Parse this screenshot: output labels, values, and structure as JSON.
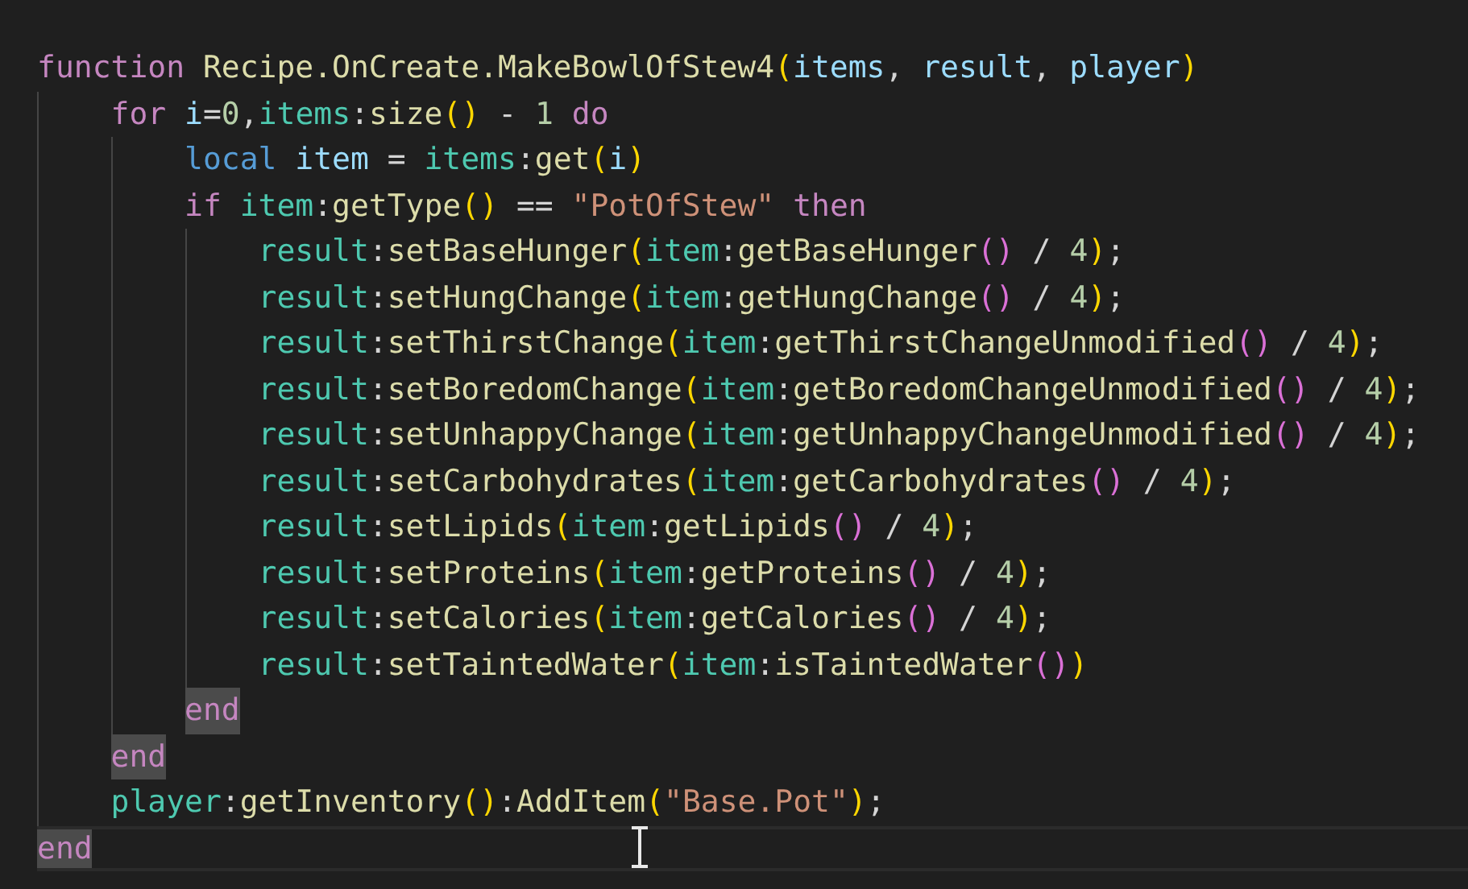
{
  "editor": {
    "lines": [
      {
        "current": false,
        "tokens": [
          {
            "kind": "keyword",
            "text": "function",
            "highlighted": false,
            "space_after": true
          },
          {
            "kind": "function",
            "text": "Recipe.OnCreate.MakeBowlOfStew4"
          },
          {
            "kind": "bracket",
            "text": "(",
            "color": "#ffd700"
          },
          {
            "kind": "parameter",
            "text": "items"
          },
          {
            "kind": "operator",
            "text": ",",
            "space_after": true
          },
          {
            "kind": "parameter",
            "text": "result"
          },
          {
            "kind": "operator",
            "text": ",",
            "space_after": true
          },
          {
            "kind": "parameter",
            "text": "player"
          },
          {
            "kind": "bracket",
            "text": ")",
            "color": "#ffd700"
          }
        ],
        "children": [
          {
            "current": false,
            "tokens": [
              {
                "kind": "keyword",
                "text": "for",
                "highlighted": false,
                "space_after": true
              },
              {
                "kind": "parameter",
                "text": "i"
              },
              {
                "kind": "operator",
                "text": "="
              },
              {
                "kind": "number",
                "text": "0"
              },
              {
                "kind": "operator",
                "text": ","
              },
              {
                "kind": "object",
                "text": "items"
              },
              {
                "kind": "operator",
                "text": ":"
              },
              {
                "kind": "function",
                "text": "size"
              },
              {
                "kind": "bracket",
                "text": "(",
                "color": "#ffd700"
              },
              {
                "kind": "bracket",
                "text": ")",
                "color": "#ffd700",
                "space_after": true
              },
              {
                "kind": "operator",
                "text": "-",
                "space_after": true
              },
              {
                "kind": "number",
                "text": "1",
                "space_after": true
              },
              {
                "kind": "keyword",
                "text": "do",
                "highlighted": false
              }
            ],
            "children": [
              {
                "current": false,
                "tokens": [
                  {
                    "kind": "storage",
                    "text": "local",
                    "space_after": true
                  },
                  {
                    "kind": "parameter",
                    "text": "item",
                    "space_after": true
                  },
                  {
                    "kind": "operator",
                    "text": "=",
                    "space_after": true
                  },
                  {
                    "kind": "object",
                    "text": "items"
                  },
                  {
                    "kind": "operator",
                    "text": ":"
                  },
                  {
                    "kind": "function",
                    "text": "get"
                  },
                  {
                    "kind": "bracket",
                    "text": "(",
                    "color": "#ffd700"
                  },
                  {
                    "kind": "parameter",
                    "text": "i"
                  },
                  {
                    "kind": "bracket",
                    "text": ")",
                    "color": "#ffd700"
                  }
                ]
              },
              {
                "current": false,
                "tokens": [
                  {
                    "kind": "keyword",
                    "text": "if",
                    "highlighted": false,
                    "space_after": true
                  },
                  {
                    "kind": "object",
                    "text": "item"
                  },
                  {
                    "kind": "operator",
                    "text": ":"
                  },
                  {
                    "kind": "function",
                    "text": "getType"
                  },
                  {
                    "kind": "bracket",
                    "text": "(",
                    "color": "#ffd700"
                  },
                  {
                    "kind": "bracket",
                    "text": ")",
                    "color": "#ffd700",
                    "space_after": true
                  },
                  {
                    "kind": "operator",
                    "text": "==",
                    "space_after": true
                  },
                  {
                    "kind": "string",
                    "text": "\"PotOfStew\"",
                    "space_after": true
                  },
                  {
                    "kind": "keyword",
                    "text": "then",
                    "highlighted": false
                  }
                ],
                "children": [
                  {
                    "current": false,
                    "tokens": [
                      {
                        "kind": "object",
                        "text": "result"
                      },
                      {
                        "kind": "operator",
                        "text": ":"
                      },
                      {
                        "kind": "function",
                        "text": "setBaseHunger"
                      },
                      {
                        "kind": "bracket",
                        "text": "(",
                        "color": "#ffd700"
                      },
                      {
                        "kind": "object",
                        "text": "item"
                      },
                      {
                        "kind": "operator",
                        "text": ":"
                      },
                      {
                        "kind": "function",
                        "text": "getBaseHunger"
                      },
                      {
                        "kind": "bracket",
                        "text": "(",
                        "color": "#da70d6"
                      },
                      {
                        "kind": "bracket",
                        "text": ")",
                        "color": "#da70d6",
                        "space_after": true
                      },
                      {
                        "kind": "operator",
                        "text": "/",
                        "space_after": true
                      },
                      {
                        "kind": "number",
                        "text": "4"
                      },
                      {
                        "kind": "bracket",
                        "text": ")",
                        "color": "#ffd700"
                      },
                      {
                        "kind": "operator",
                        "text": ";"
                      }
                    ]
                  },
                  {
                    "current": false,
                    "tokens": [
                      {
                        "kind": "object",
                        "text": "result"
                      },
                      {
                        "kind": "operator",
                        "text": ":"
                      },
                      {
                        "kind": "function",
                        "text": "setHungChange"
                      },
                      {
                        "kind": "bracket",
                        "text": "(",
                        "color": "#ffd700"
                      },
                      {
                        "kind": "object",
                        "text": "item"
                      },
                      {
                        "kind": "operator",
                        "text": ":"
                      },
                      {
                        "kind": "function",
                        "text": "getHungChange"
                      },
                      {
                        "kind": "bracket",
                        "text": "(",
                        "color": "#da70d6"
                      },
                      {
                        "kind": "bracket",
                        "text": ")",
                        "color": "#da70d6",
                        "space_after": true
                      },
                      {
                        "kind": "operator",
                        "text": "/",
                        "space_after": true
                      },
                      {
                        "kind": "number",
                        "text": "4"
                      },
                      {
                        "kind": "bracket",
                        "text": ")",
                        "color": "#ffd700"
                      },
                      {
                        "kind": "operator",
                        "text": ";"
                      }
                    ]
                  },
                  {
                    "current": false,
                    "tokens": [
                      {
                        "kind": "object",
                        "text": "result"
                      },
                      {
                        "kind": "operator",
                        "text": ":"
                      },
                      {
                        "kind": "function",
                        "text": "setThirstChange"
                      },
                      {
                        "kind": "bracket",
                        "text": "(",
                        "color": "#ffd700"
                      },
                      {
                        "kind": "object",
                        "text": "item"
                      },
                      {
                        "kind": "operator",
                        "text": ":"
                      },
                      {
                        "kind": "function",
                        "text": "getThirstChangeUnmodified"
                      },
                      {
                        "kind": "bracket",
                        "text": "(",
                        "color": "#da70d6"
                      },
                      {
                        "kind": "bracket",
                        "text": ")",
                        "color": "#da70d6",
                        "space_after": true
                      },
                      {
                        "kind": "operator",
                        "text": "/",
                        "space_after": true
                      },
                      {
                        "kind": "number",
                        "text": "4"
                      },
                      {
                        "kind": "bracket",
                        "text": ")",
                        "color": "#ffd700"
                      },
                      {
                        "kind": "operator",
                        "text": ";"
                      }
                    ]
                  },
                  {
                    "current": false,
                    "tokens": [
                      {
                        "kind": "object",
                        "text": "result"
                      },
                      {
                        "kind": "operator",
                        "text": ":"
                      },
                      {
                        "kind": "function",
                        "text": "setBoredomChange"
                      },
                      {
                        "kind": "bracket",
                        "text": "(",
                        "color": "#ffd700"
                      },
                      {
                        "kind": "object",
                        "text": "item"
                      },
                      {
                        "kind": "operator",
                        "text": ":"
                      },
                      {
                        "kind": "function",
                        "text": "getBoredomChangeUnmodified"
                      },
                      {
                        "kind": "bracket",
                        "text": "(",
                        "color": "#da70d6"
                      },
                      {
                        "kind": "bracket",
                        "text": ")",
                        "color": "#da70d6",
                        "space_after": true
                      },
                      {
                        "kind": "operator",
                        "text": "/",
                        "space_after": true
                      },
                      {
                        "kind": "number",
                        "text": "4"
                      },
                      {
                        "kind": "bracket",
                        "text": ")",
                        "color": "#ffd700"
                      },
                      {
                        "kind": "operator",
                        "text": ";"
                      }
                    ]
                  },
                  {
                    "current": false,
                    "tokens": [
                      {
                        "kind": "object",
                        "text": "result"
                      },
                      {
                        "kind": "operator",
                        "text": ":"
                      },
                      {
                        "kind": "function",
                        "text": "setUnhappyChange"
                      },
                      {
                        "kind": "bracket",
                        "text": "(",
                        "color": "#ffd700"
                      },
                      {
                        "kind": "object",
                        "text": "item"
                      },
                      {
                        "kind": "operator",
                        "text": ":"
                      },
                      {
                        "kind": "function",
                        "text": "getUnhappyChangeUnmodified"
                      },
                      {
                        "kind": "bracket",
                        "text": "(",
                        "color": "#da70d6"
                      },
                      {
                        "kind": "bracket",
                        "text": ")",
                        "color": "#da70d6",
                        "space_after": true
                      },
                      {
                        "kind": "operator",
                        "text": "/",
                        "space_after": true
                      },
                      {
                        "kind": "number",
                        "text": "4"
                      },
                      {
                        "kind": "bracket",
                        "text": ")",
                        "color": "#ffd700"
                      },
                      {
                        "kind": "operator",
                        "text": ";"
                      }
                    ]
                  },
                  {
                    "current": false,
                    "tokens": [
                      {
                        "kind": "object",
                        "text": "result"
                      },
                      {
                        "kind": "operator",
                        "text": ":"
                      },
                      {
                        "kind": "function",
                        "text": "setCarbohydrates"
                      },
                      {
                        "kind": "bracket",
                        "text": "(",
                        "color": "#ffd700"
                      },
                      {
                        "kind": "object",
                        "text": "item"
                      },
                      {
                        "kind": "operator",
                        "text": ":"
                      },
                      {
                        "kind": "function",
                        "text": "getCarbohydrates"
                      },
                      {
                        "kind": "bracket",
                        "text": "(",
                        "color": "#da70d6"
                      },
                      {
                        "kind": "bracket",
                        "text": ")",
                        "color": "#da70d6",
                        "space_after": true
                      },
                      {
                        "kind": "operator",
                        "text": "/",
                        "space_after": true
                      },
                      {
                        "kind": "number",
                        "text": "4"
                      },
                      {
                        "kind": "bracket",
                        "text": ")",
                        "color": "#ffd700"
                      },
                      {
                        "kind": "operator",
                        "text": ";"
                      }
                    ]
                  },
                  {
                    "current": false,
                    "tokens": [
                      {
                        "kind": "object",
                        "text": "result"
                      },
                      {
                        "kind": "operator",
                        "text": ":"
                      },
                      {
                        "kind": "function",
                        "text": "setLipids"
                      },
                      {
                        "kind": "bracket",
                        "text": "(",
                        "color": "#ffd700"
                      },
                      {
                        "kind": "object",
                        "text": "item"
                      },
                      {
                        "kind": "operator",
                        "text": ":"
                      },
                      {
                        "kind": "function",
                        "text": "getLipids"
                      },
                      {
                        "kind": "bracket",
                        "text": "(",
                        "color": "#da70d6"
                      },
                      {
                        "kind": "bracket",
                        "text": ")",
                        "color": "#da70d6",
                        "space_after": true
                      },
                      {
                        "kind": "operator",
                        "text": "/",
                        "space_after": true
                      },
                      {
                        "kind": "number",
                        "text": "4"
                      },
                      {
                        "kind": "bracket",
                        "text": ")",
                        "color": "#ffd700"
                      },
                      {
                        "kind": "operator",
                        "text": ";"
                      }
                    ]
                  },
                  {
                    "current": false,
                    "tokens": [
                      {
                        "kind": "object",
                        "text": "result"
                      },
                      {
                        "kind": "operator",
                        "text": ":"
                      },
                      {
                        "kind": "function",
                        "text": "setProteins"
                      },
                      {
                        "kind": "bracket",
                        "text": "(",
                        "color": "#ffd700"
                      },
                      {
                        "kind": "object",
                        "text": "item"
                      },
                      {
                        "kind": "operator",
                        "text": ":"
                      },
                      {
                        "kind": "function",
                        "text": "getProteins"
                      },
                      {
                        "kind": "bracket",
                        "text": "(",
                        "color": "#da70d6"
                      },
                      {
                        "kind": "bracket",
                        "text": ")",
                        "color": "#da70d6",
                        "space_after": true
                      },
                      {
                        "kind": "operator",
                        "text": "/",
                        "space_after": true
                      },
                      {
                        "kind": "number",
                        "text": "4"
                      },
                      {
                        "kind": "bracket",
                        "text": ")",
                        "color": "#ffd700"
                      },
                      {
                        "kind": "operator",
                        "text": ";"
                      }
                    ]
                  },
                  {
                    "current": false,
                    "tokens": [
                      {
                        "kind": "object",
                        "text": "result"
                      },
                      {
                        "kind": "operator",
                        "text": ":"
                      },
                      {
                        "kind": "function",
                        "text": "setCalories"
                      },
                      {
                        "kind": "bracket",
                        "text": "(",
                        "color": "#ffd700"
                      },
                      {
                        "kind": "object",
                        "text": "item"
                      },
                      {
                        "kind": "operator",
                        "text": ":"
                      },
                      {
                        "kind": "function",
                        "text": "getCalories"
                      },
                      {
                        "kind": "bracket",
                        "text": "(",
                        "color": "#da70d6"
                      },
                      {
                        "kind": "bracket",
                        "text": ")",
                        "color": "#da70d6",
                        "space_after": true
                      },
                      {
                        "kind": "operator",
                        "text": "/",
                        "space_after": true
                      },
                      {
                        "kind": "number",
                        "text": "4"
                      },
                      {
                        "kind": "bracket",
                        "text": ")",
                        "color": "#ffd700"
                      },
                      {
                        "kind": "operator",
                        "text": ";"
                      }
                    ]
                  },
                  {
                    "current": false,
                    "tokens": [
                      {
                        "kind": "object",
                        "text": "result"
                      },
                      {
                        "kind": "operator",
                        "text": ":"
                      },
                      {
                        "kind": "function",
                        "text": "setTaintedWater"
                      },
                      {
                        "kind": "bracket",
                        "text": "(",
                        "color": "#ffd700"
                      },
                      {
                        "kind": "object",
                        "text": "item"
                      },
                      {
                        "kind": "operator",
                        "text": ":"
                      },
                      {
                        "kind": "function",
                        "text": "isTaintedWater"
                      },
                      {
                        "kind": "bracket",
                        "text": "(",
                        "color": "#da70d6"
                      },
                      {
                        "kind": "bracket",
                        "text": ")",
                        "color": "#da70d6"
                      },
                      {
                        "kind": "bracket",
                        "text": ")",
                        "color": "#ffd700"
                      }
                    ]
                  }
                ]
              },
              {
                "current": false,
                "tokens": [
                  {
                    "kind": "keyword",
                    "text": "end",
                    "highlighted": true
                  }
                ]
              }
            ]
          },
          {
            "current": false,
            "tokens": [
              {
                "kind": "keyword",
                "text": "end",
                "highlighted": true
              }
            ]
          },
          {
            "current": false,
            "tokens": [
              {
                "kind": "object",
                "text": "player"
              },
              {
                "kind": "operator",
                "text": ":"
              },
              {
                "kind": "function",
                "text": "getInventory"
              },
              {
                "kind": "bracket",
                "text": "(",
                "color": "#ffd700"
              },
              {
                "kind": "bracket",
                "text": ")",
                "color": "#ffd700"
              },
              {
                "kind": "operator",
                "text": ":"
              },
              {
                "kind": "function",
                "text": "AddItem"
              },
              {
                "kind": "bracket",
                "text": "(",
                "color": "#ffd700"
              },
              {
                "kind": "string",
                "text": "\"Base.Pot\""
              },
              {
                "kind": "bracket",
                "text": ")",
                "color": "#ffd700"
              },
              {
                "kind": "operator",
                "text": ";"
              }
            ]
          }
        ]
      },
      {
        "current": true,
        "tokens": [
          {
            "kind": "keyword",
            "text": "end",
            "highlighted": true
          }
        ]
      }
    ]
  }
}
